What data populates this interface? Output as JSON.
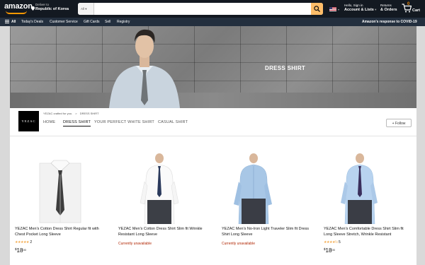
{
  "header": {
    "logo": "amazon",
    "deliver_label": "Deliver to",
    "deliver_location": "Republic of Korea",
    "search_category": "All",
    "account_hello": "Hello, Sign in",
    "account_label": "Account & Lists",
    "returns_label": "Returns",
    "orders_label": "& Orders",
    "cart_count": "0",
    "cart_label": "Cart"
  },
  "navbar": {
    "all": "All",
    "items": [
      "Today's Deals",
      "Customer Service",
      "Gift Cards",
      "Sell",
      "Registry"
    ],
    "covid": "Amazon's response to COVID-19"
  },
  "hero": {
    "title": "DRESS SHIRT"
  },
  "brand": {
    "logo_text": "YEZAC",
    "breadcrumb": [
      "YEZAC crafted for you.",
      ">",
      "DRESS SHIRT"
    ],
    "tabs": [
      "HOME",
      "DRESS SHIRT",
      "YOUR PERFECT WHITE SHIRT",
      "CASUAL SHIRT"
    ],
    "active_tab": "DRESS SHIRT",
    "follow": "+ Follow"
  },
  "products": [
    {
      "name": "YEZAC Men's Cotton Dress Shirt Regular fit with Chest Pocket Long Sleeve",
      "stars": "★★★★★",
      "reviews": "2",
      "currency": "$",
      "price_whole": "18",
      "price_frac": "00",
      "status": ""
    },
    {
      "name": "YEZAC Men's Cotton Dress Shirt Slim fit Wrinkle Resistant Long Sleeve",
      "stars": "",
      "reviews": "",
      "currency": "",
      "price_whole": "",
      "price_frac": "",
      "status": "Currently unavailable"
    },
    {
      "name": "YEZAC Men's No-Iron Light Traveler Slim fit Dress Shirt Long Sleeve",
      "stars": "",
      "reviews": "",
      "currency": "",
      "price_whole": "",
      "price_frac": "",
      "status": "Currently unavailable"
    },
    {
      "name": "YEZAC Men's Comfortable Dress Shirt Slim fit Long Sleeve Stretch, Wrinkle Resistant",
      "stars": "★★★★½",
      "reviews": "5",
      "currency": "$",
      "price_whole": "18",
      "price_frac": "00",
      "status": ""
    }
  ],
  "colors": {
    "topbar": "#131921",
    "navbar": "#232f3e",
    "search_button": "#febd69",
    "unavailable": "#b12704",
    "star": "#f3a847"
  }
}
